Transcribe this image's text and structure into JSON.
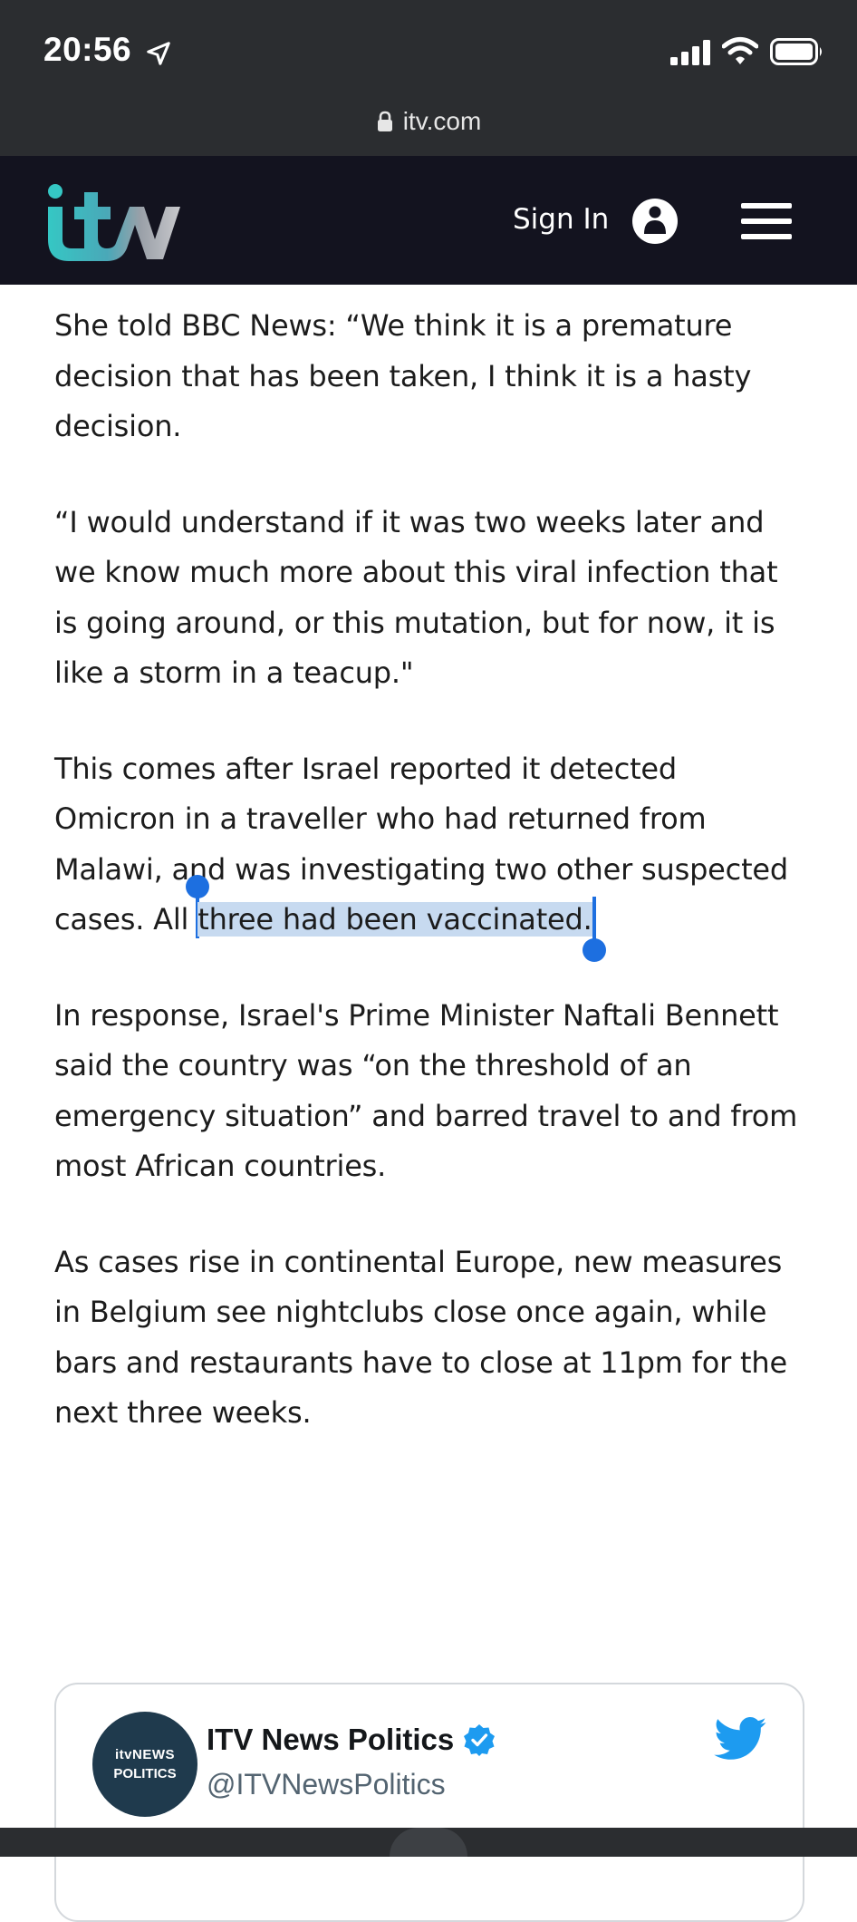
{
  "status_bar": {
    "time": "20:56",
    "icons": [
      "location-arrow-icon",
      "cellular-signal-icon",
      "wifi-icon",
      "battery-icon"
    ]
  },
  "browser": {
    "url": "itv.com",
    "lock_icon": "lock-icon"
  },
  "header": {
    "logo_text": "itv",
    "sign_in_label": "Sign In",
    "account_icon": "account-icon",
    "menu_icon": "hamburger-menu-icon",
    "background": "#13131f"
  },
  "article": {
    "p1": "She told BBC News: “We think it is a premature decision that has been taken, I think it is a hasty decision.",
    "p2": "“I would understand if it was two weeks later and we know much more about this viral infection that is going around, or this mutation, but for now, it is like a storm in a teacup.\"",
    "p3_before": "This comes after Israel reported it detected Omicron in a traveller who had returned from Malawi, and was investigating two other suspected cases. All ",
    "p3_selected": "three had been vaccinated.",
    "p4": "In response, Israel's Prime Minister Naftali Bennett said the country was “on the threshold of an emergency situation” and barred travel to and from most African countries.",
    "p5": "As cases rise in continental Europe, new measures in Belgium see nightclubs close once again, while bars and restaurants have to close at 11pm for the next three weeks.",
    "selection_color": "#c7daf0",
    "selection_handle_color": "#1d6fe0"
  },
  "tweet": {
    "avatar_line1": "itvNEWS",
    "avatar_line2": "POLITICS",
    "name": "ITV News Politics",
    "handle": "@ITVNewsPolitics",
    "verified_icon": "verified-badge-icon",
    "brand_icon": "twitter-bird-icon",
    "brand_color": "#1d9bf0"
  }
}
